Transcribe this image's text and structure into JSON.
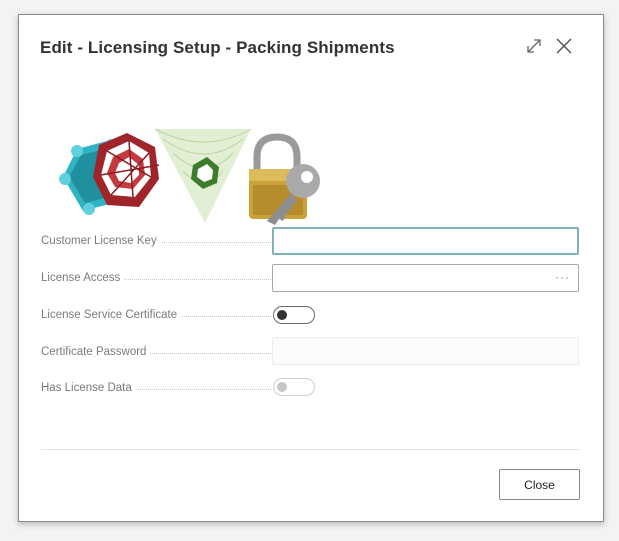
{
  "dialog": {
    "title": "Edit - Licensing Setup - Packing Shipments"
  },
  "fields": [
    {
      "label": "Customer License Key",
      "value": ""
    },
    {
      "label": "License Access",
      "value": "",
      "lookup_glyph": "···"
    },
    {
      "label": "License Service Certificate",
      "toggle": false
    },
    {
      "label": "Certificate Password",
      "value": ""
    },
    {
      "label": "Has License Data",
      "toggle": false
    }
  ],
  "footer": {
    "close_label": "Close"
  },
  "colors": {
    "focus_border": "#7fb0bc",
    "logo_teal": "#2fb4c4",
    "logo_red": "#a0252b",
    "padlock_gold": "#c9a23a"
  }
}
